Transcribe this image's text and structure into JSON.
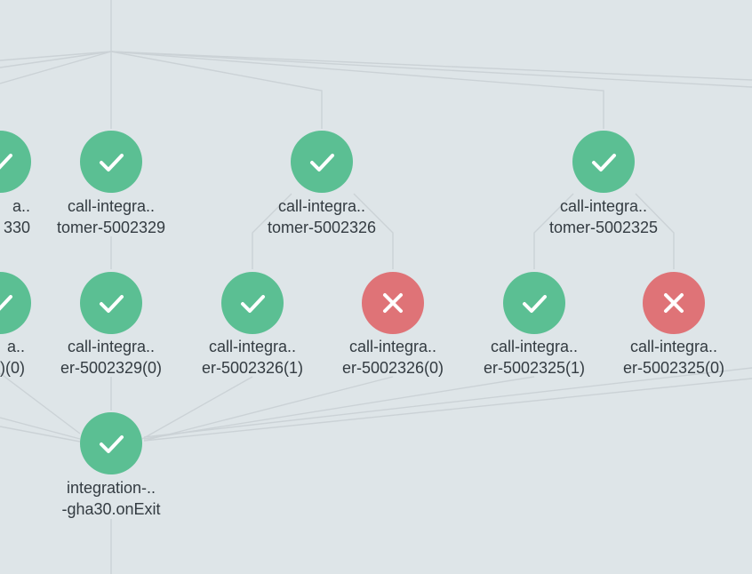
{
  "colors": {
    "background": "#dee5e8",
    "edge": "#cbd2d6",
    "succeeded": "#5bbf93",
    "failed": "#df7377",
    "label_text": "#333b41",
    "icon_stroke": "#ffffff"
  },
  "nodes": [
    {
      "id": "n330",
      "status": "succeeded",
      "icon": "check-icon",
      "label": [
        "a..",
        "330"
      ]
    },
    {
      "id": "n329",
      "status": "succeeded",
      "icon": "check-icon",
      "label": [
        "call-integra..",
        "tomer-5002329"
      ]
    },
    {
      "id": "n326",
      "status": "succeeded",
      "icon": "check-icon",
      "label": [
        "call-integra..",
        "tomer-5002326"
      ]
    },
    {
      "id": "n325",
      "status": "succeeded",
      "icon": "check-icon",
      "label": [
        "call-integra..",
        "tomer-5002325"
      ]
    },
    {
      "id": "n330c",
      "status": "succeeded",
      "icon": "check-icon",
      "label": [
        "a..",
        ")(0)"
      ]
    },
    {
      "id": "n329c0",
      "status": "succeeded",
      "icon": "check-icon",
      "label": [
        "call-integra..",
        "er-5002329(0)"
      ]
    },
    {
      "id": "n326c1",
      "status": "succeeded",
      "icon": "check-icon",
      "label": [
        "call-integra..",
        "er-5002326(1)"
      ]
    },
    {
      "id": "n326c0",
      "status": "failed",
      "icon": "x-icon",
      "label": [
        "call-integra..",
        "er-5002326(0)"
      ]
    },
    {
      "id": "n325c1",
      "status": "succeeded",
      "icon": "check-icon",
      "label": [
        "call-integra..",
        "er-5002325(1)"
      ]
    },
    {
      "id": "n325c0",
      "status": "failed",
      "icon": "x-icon",
      "label": [
        "call-integra..",
        "er-5002325(0)"
      ]
    },
    {
      "id": "exit",
      "status": "succeeded",
      "icon": "check-icon",
      "label": [
        "integration-..",
        "-gha30.onExit"
      ]
    }
  ]
}
